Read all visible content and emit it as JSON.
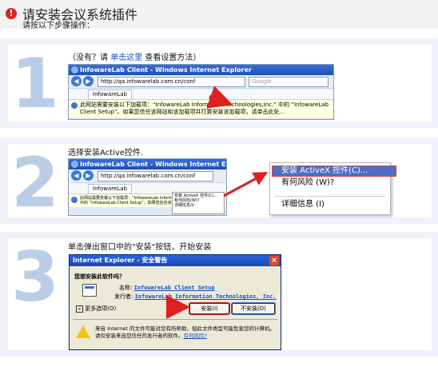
{
  "header": {
    "title": "请安装会议系统插件",
    "subtitle": "请按以下步骤操作："
  },
  "steps": [
    {
      "number": "1",
      "text_before": "（没有？请 ",
      "link": "单击这里",
      "text_after": " 查看设置方法）",
      "browser": {
        "title": "InfowareLab Client - Windows Internet Explorer",
        "url": "http://qa.infowarelab.com.cn/conf",
        "search_placeholder": "Google",
        "tab": "InfowareLab",
        "infobar": "此网站需要安装以下加载项：“InfowareLab Information Technologies,Inc.” 中的 “InfowareLab Client Setup”。如果您信任该网站和该加载项并打算安装该加载项，请单击此处..."
      }
    },
    {
      "number": "2",
      "text": "选择安装Active控件.",
      "browser": {
        "title": "InfowareLab Client - Windows Internet Explorer",
        "url": "http://qa.infowarelab.com.cn/conf",
        "tab": "InfowareLab",
        "infobar": "此网站需要安装以下加载项：“InfowareLab Information Technologies,Inc.” 中的 “InfowareLab Client Setup”。如果您信任该网站..."
      },
      "mini_menu": [
        "安装 ActiveX 控件(C)...",
        "有何风险(W)?",
        "详细信息(I)"
      ],
      "context_menu": [
        "安装 ActiveX 控件(C)...",
        "有何风险 (W)?",
        "详细信息 (I)"
      ]
    },
    {
      "number": "3",
      "text": "单击弹出窗口中的\"安装\"按钮，开始安装",
      "dialog": {
        "title": "Internet Explorer - 安全警告",
        "question": "您想安装此软件吗？",
        "name_label": "名称:",
        "name_value": "InfowareLab Client Setup",
        "publisher_label": "发行者:",
        "publisher_value": "InfowareLab Information Technologies, Inc.",
        "more_options": "更多选项(O)",
        "install_button": "安装(I)",
        "noinstall_button": "不安装(D)",
        "warning": "来自 Internet 的文件可能对您有所帮助，但此文件类型可能危害您的计算机。请仅安装来自您信任的发行者的软件。",
        "risk_link": "有何风险?"
      }
    }
  ],
  "colors": {
    "step_bg": "#eef2f8",
    "number_color": "#b9cde6",
    "link": "#1a4fbf",
    "arrow": "#e02020",
    "alert": "#d9261c"
  }
}
